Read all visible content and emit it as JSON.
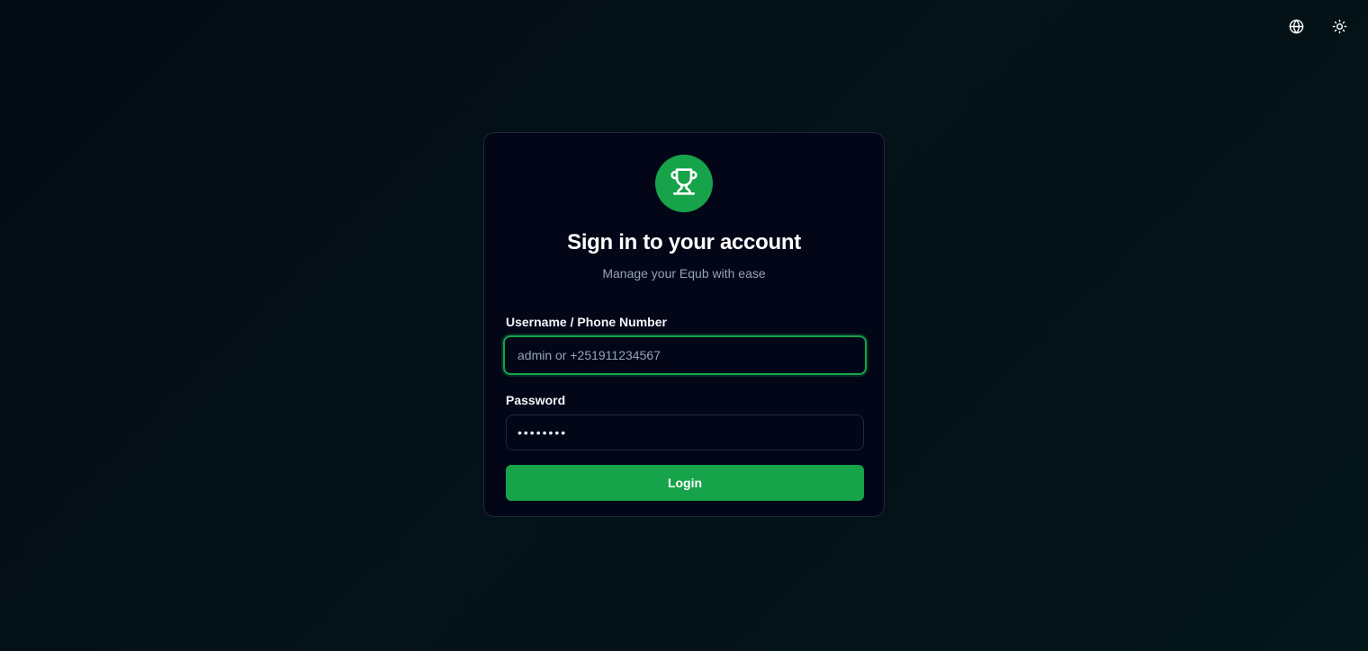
{
  "header": {
    "language_icon": "globe-icon",
    "theme_icon": "sun-icon"
  },
  "card": {
    "logo_icon": "trophy-icon",
    "title": "Sign in to your account",
    "subtitle": "Manage your Equb with ease"
  },
  "form": {
    "username": {
      "label": "Username / Phone Number",
      "value": "",
      "placeholder": "admin or +251911234567"
    },
    "password": {
      "label": "Password",
      "value": "••••••••",
      "placeholder": ""
    },
    "submit_label": "Login"
  },
  "colors": {
    "accent": "#16a34a",
    "background": "#020617",
    "card_border": "#1e293b",
    "muted_text": "#94a3b8"
  }
}
